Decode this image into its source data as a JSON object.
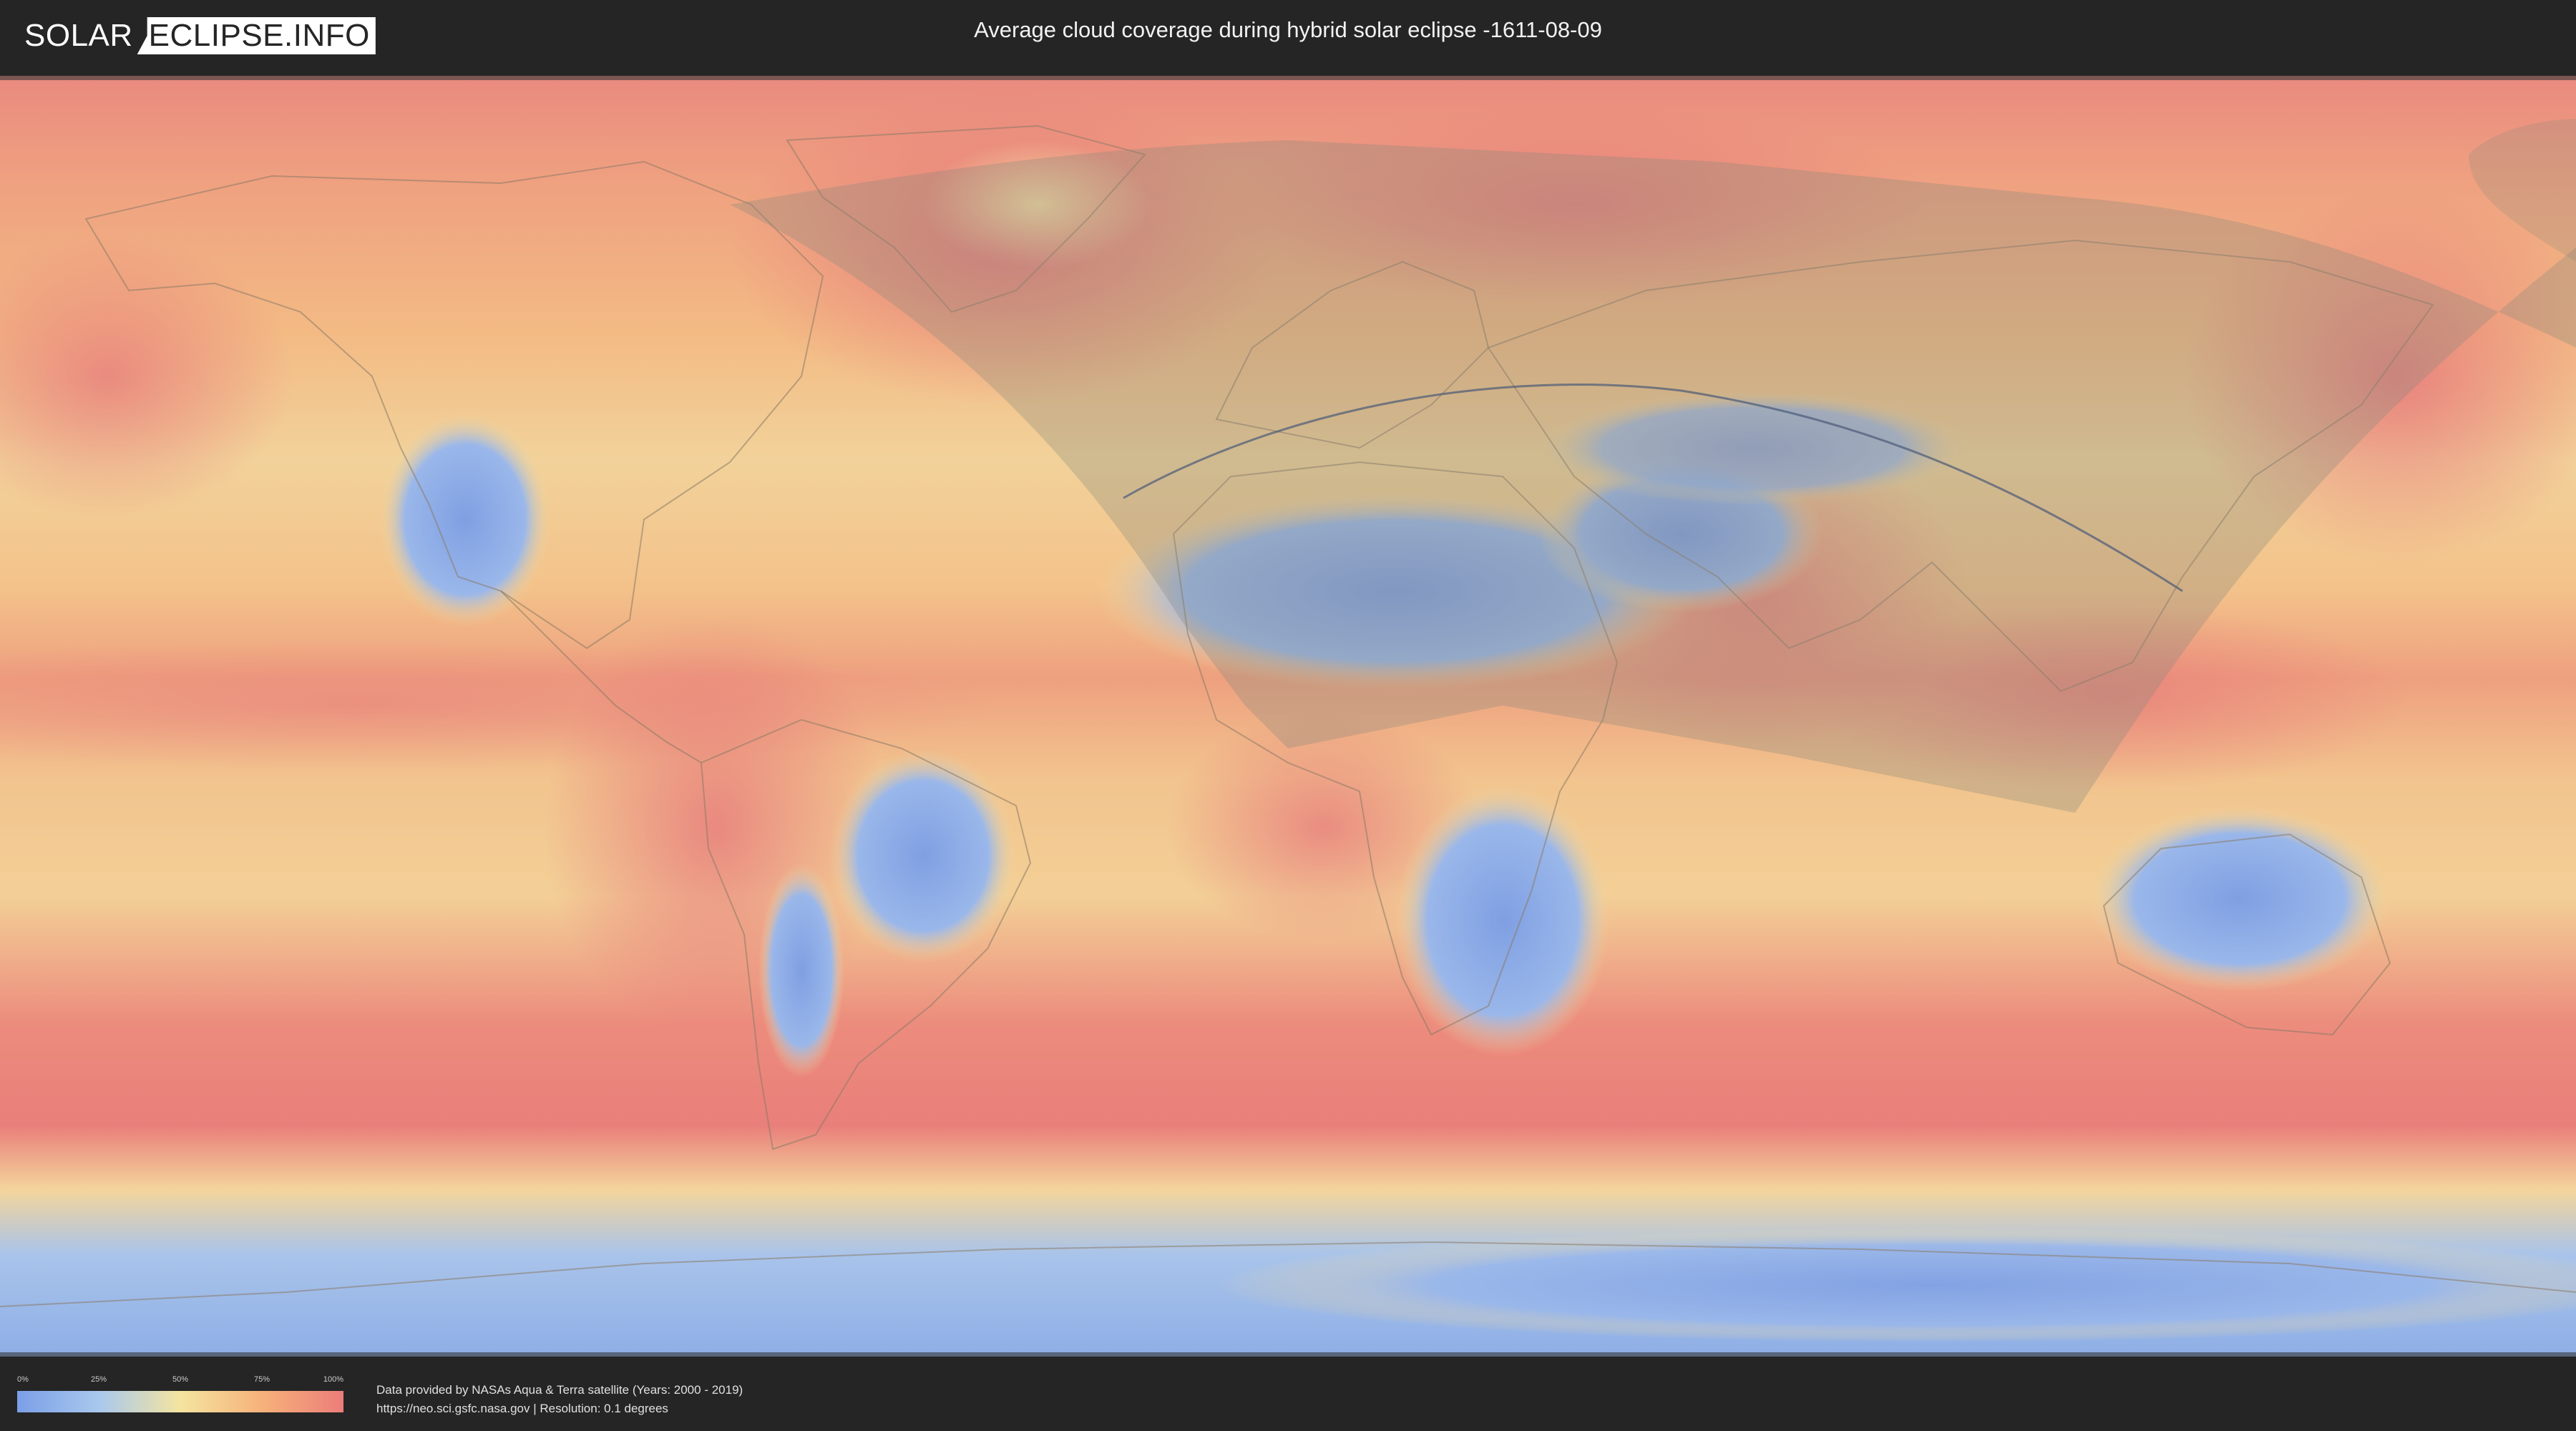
{
  "header": {
    "logo_left": "SOLAR",
    "logo_right": "ECLIPSE.INFO",
    "title": "Average cloud coverage during hybrid solar eclipse -1611-08-09"
  },
  "map": {
    "layers": [
      "cloud-coverage-raster",
      "country-borders",
      "eclipse-visibility-zone",
      "central-eclipse-path"
    ]
  },
  "legend": {
    "ticks": [
      "0%",
      "25%",
      "50%",
      "75%",
      "100%"
    ],
    "colors": [
      "#7a9fe6",
      "#a9c8ee",
      "#f4e4a0",
      "#f6b27a",
      "#ec7d7a"
    ]
  },
  "footer": {
    "credit_line1": "Data provided by NASAs Aqua & Terra satellite (Years: 2000 - 2019)",
    "credit_line2": "https://neo.sci.gsfc.nasa.gov | Resolution: 0.1 degrees"
  }
}
